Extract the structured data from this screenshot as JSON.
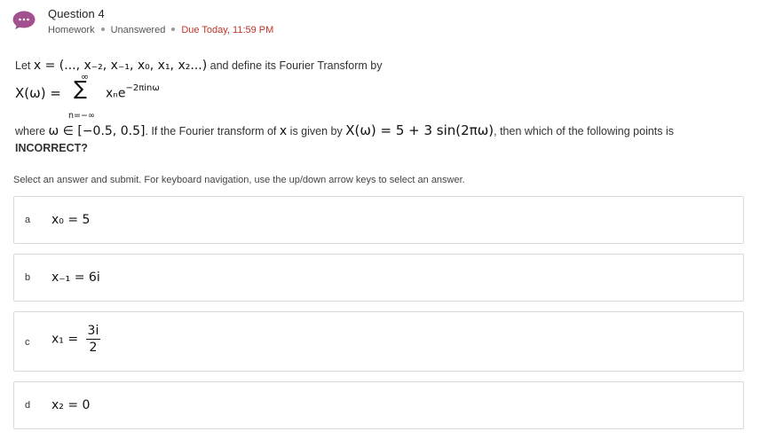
{
  "header": {
    "title": "Question 4",
    "meta_type": "Homework",
    "meta_status": "Unanswered",
    "meta_due": "Due Today, 11:59 PM",
    "icon": "chat-bubble-icon",
    "icon_color": "#a2508f",
    "due_color": "#c2332a"
  },
  "prompt": {
    "line1_prefix": "Let ",
    "line1_math": "x = (..., x₋₂, x₋₁, x₀, x₁, x₂...)",
    "line1_suffix": " and define its Fourier Transform by",
    "eq_lhs": "X(ω) =",
    "sum_symbol": "∑",
    "sum_upper": "∞",
    "sum_lower": "n=−∞",
    "sum_term_base": "xₙe",
    "sum_term_exp": "−2πinω",
    "line3_a": "where ",
    "line3_math1": "ω ∈ [−0.5, 0.5]",
    "line3_b": ". If the Fourier transform of ",
    "line3_math2": "x",
    "line3_c": " is given by ",
    "line3_math3": "X(ω) = 5 + 3 sin(2πω)",
    "line3_d": ", then which of the following points is",
    "line4": "INCORRECT?"
  },
  "instructions": "Select an answer and submit. For keyboard navigation, use the up/down arrow keys to select an answer.",
  "options": [
    {
      "letter": "a",
      "math": "x₀ = 5"
    },
    {
      "letter": "b",
      "math": "x₋₁ = 6i"
    },
    {
      "letter": "c",
      "math_lhs": "x₁ =",
      "frac_num": "3i",
      "frac_den": "2"
    },
    {
      "letter": "d",
      "math": "x₂ = 0"
    }
  ]
}
